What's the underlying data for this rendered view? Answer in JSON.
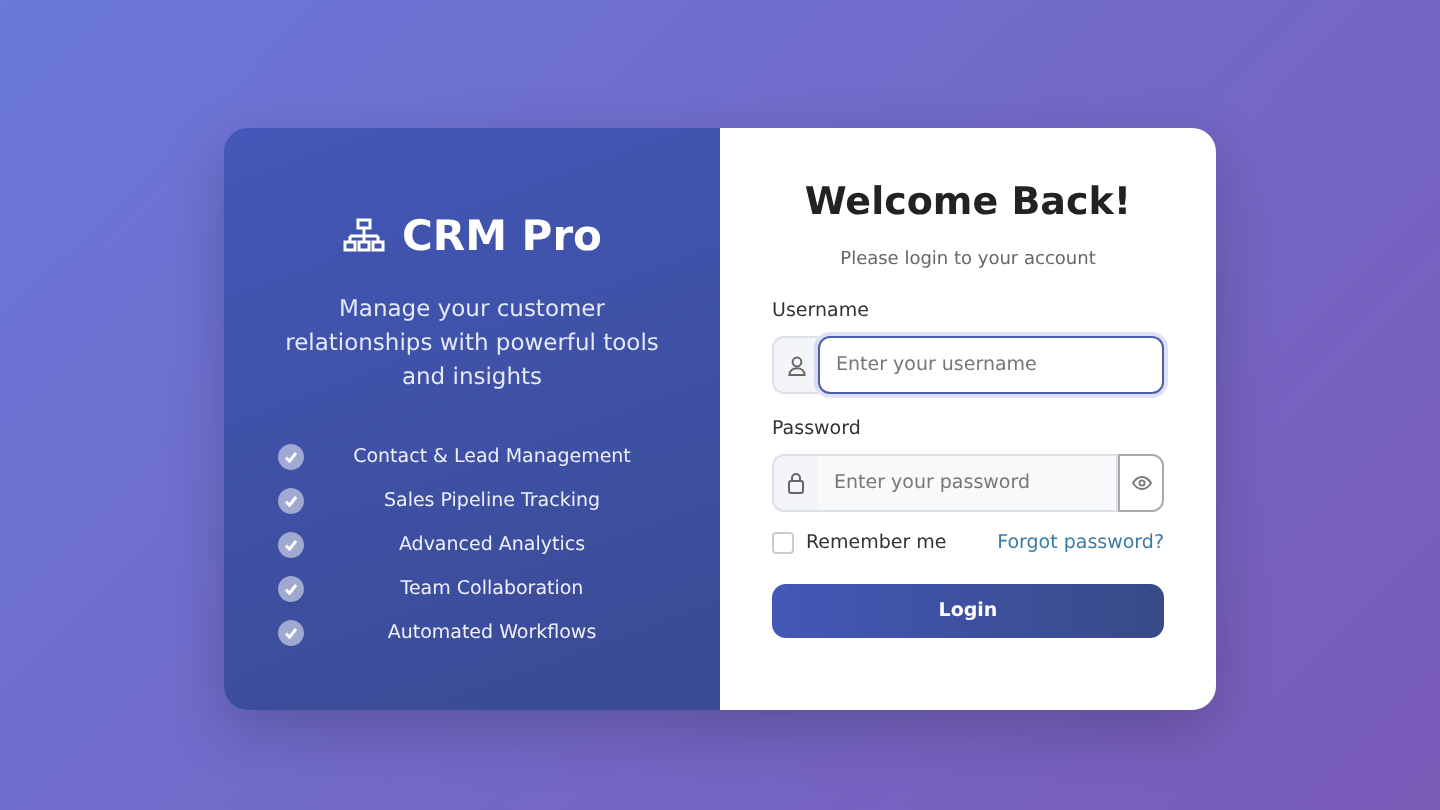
{
  "brand": {
    "title": "CRM Pro",
    "tagline": "Manage your customer relationships with powerful tools and insights",
    "features": [
      {
        "label": "Contact & Lead Management"
      },
      {
        "label": "Sales Pipeline Tracking"
      },
      {
        "label": "Advanced Analytics"
      },
      {
        "label": "Team Collaboration"
      },
      {
        "label": "Automated Workflows"
      }
    ]
  },
  "login": {
    "title": "Welcome Back!",
    "subtitle": "Please login to your account",
    "fields": [
      {
        "kind": "username",
        "label": "Username",
        "placeholder": "Enter your username",
        "focused": true
      },
      {
        "kind": "password",
        "label": "Password",
        "placeholder": "Enter your password",
        "focused": false
      }
    ],
    "remember": {
      "label": "Remember me",
      "checked": false
    },
    "forgot_link": "Forgot password?",
    "submit": "Login"
  }
}
